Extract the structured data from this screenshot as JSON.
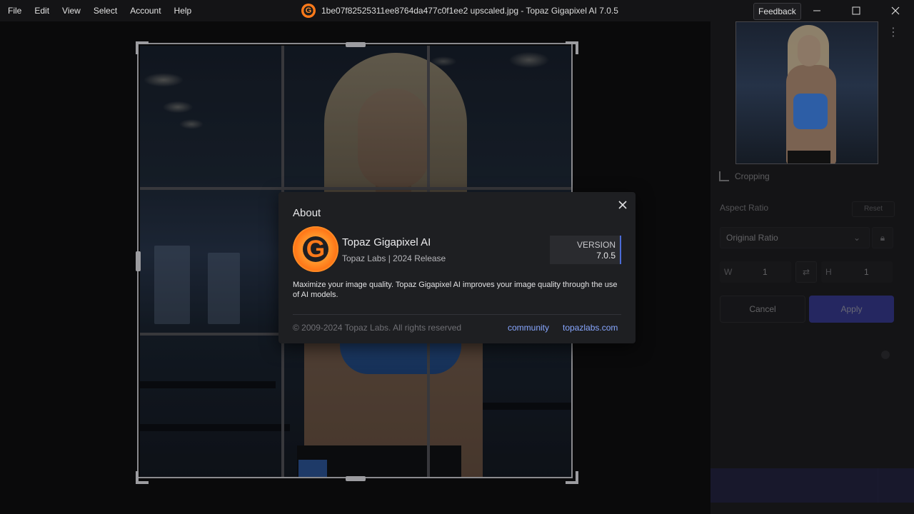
{
  "menu": [
    "File",
    "Edit",
    "View",
    "Select",
    "Account",
    "Help"
  ],
  "window": {
    "title": "1be07f82525311ee8764da477c0f1ee2 upscaled.jpg - Topaz Gigapixel AI 7.0.5",
    "feedback_label": "Feedback",
    "logo_letter": "G"
  },
  "panel": {
    "cropping_label": "Cropping",
    "aspect_ratio_label": "Aspect Ratio",
    "reset_label": "Reset",
    "ratio_value": "Original Ratio",
    "width_label": "W",
    "width_value": "1",
    "height_label": "H",
    "height_value": "1",
    "cancel_label": "Cancel",
    "apply_label": "Apply"
  },
  "dialog": {
    "title": "About",
    "app_name": "Topaz Gigapixel AI",
    "app_sub": "Topaz Labs | 2024 Release",
    "version_label": "VERSION",
    "version_value": "7.0.5",
    "description": "Maximize your image quality. Topaz Gigapixel AI improves your image quality through the use of AI models.",
    "copyright": "© 2009-2024 Topaz Labs. All rights reserved",
    "link_community": "community",
    "link_site": "topazlabs.com"
  },
  "colors": {
    "accent_blue": "#3d43c9",
    "link_blue": "#88a7ff",
    "logo_orange": "#ff7a1a"
  }
}
